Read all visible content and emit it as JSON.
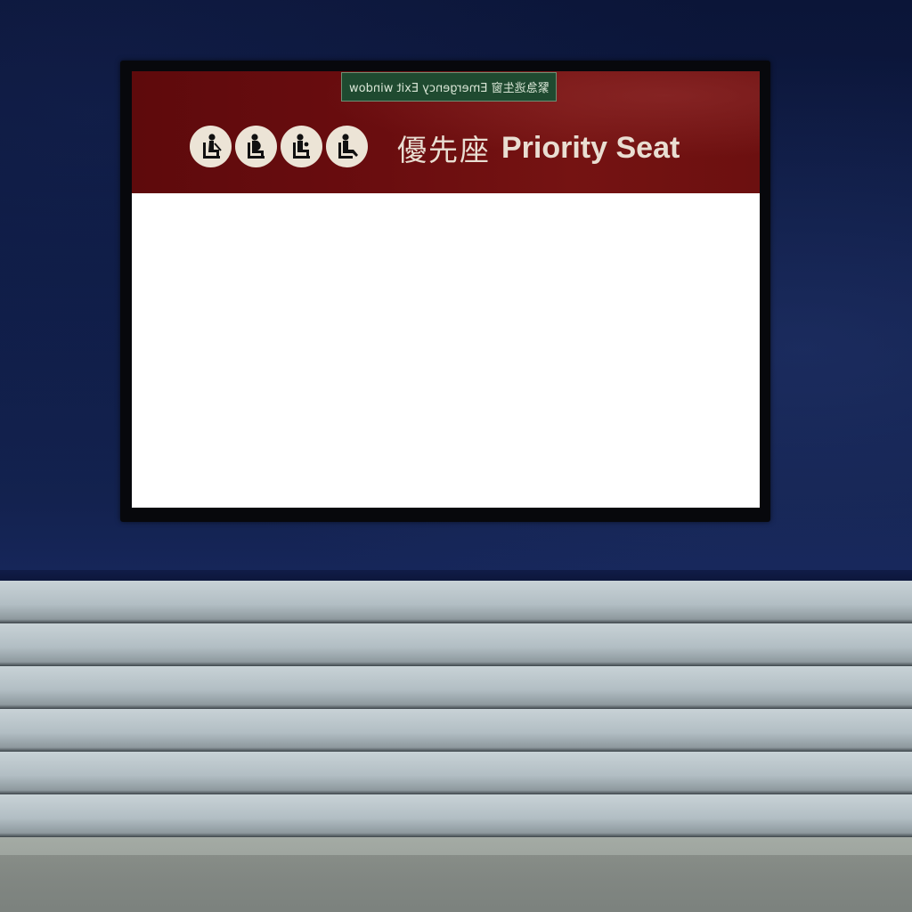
{
  "scene": {
    "description_colors": {
      "wall": "#0e1a3f",
      "sign_band": "#6a0d0f",
      "exit_label_bg": "#1f4a30",
      "bench": "#b2bec4"
    }
  },
  "sign": {
    "title_zh": "優先座",
    "title_en": "Priority Seat",
    "icons": [
      "elderly-person-icon",
      "pregnant-woman-icon",
      "person-with-child-icon",
      "injured-person-icon"
    ]
  },
  "exit_label": {
    "text": "緊急逃生窗 Emergency Exit window"
  }
}
